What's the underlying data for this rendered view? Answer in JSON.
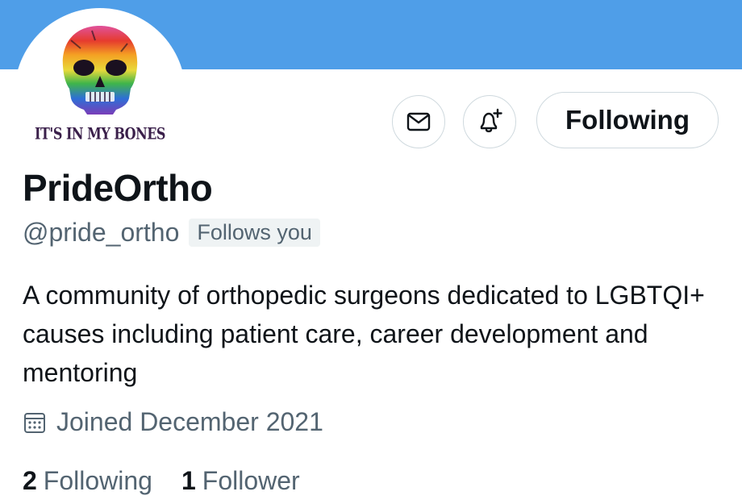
{
  "profile": {
    "display_name": "PrideOrtho",
    "handle": "@pride_ortho",
    "follows_you_badge": "Follows you",
    "bio": "A community of orthopedic surgeons dedicated to LGBTQI+ causes including patient care, career development and mentoring",
    "joined": "Joined December 2021",
    "avatar_logo_text": "IT'S IN MY BONES"
  },
  "actions": {
    "message_icon": "envelope-icon",
    "notify_icon": "bell-plus-icon",
    "follow_label": "Following"
  },
  "stats": {
    "following_count": "2",
    "following_label": "Following",
    "followers_count": "1",
    "followers_label": "Follower"
  },
  "colors": {
    "banner": "#4f9ee8",
    "text_primary": "#0f1419",
    "text_secondary": "#536471",
    "border": "#cfd9de",
    "badge_bg": "#eff3f4"
  }
}
